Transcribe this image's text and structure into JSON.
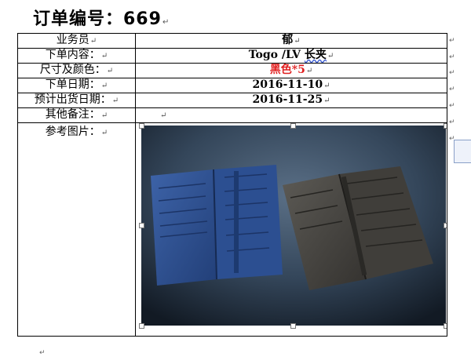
{
  "doc": {
    "title": "订单编号：669",
    "mark": "↵"
  },
  "rows": [
    {
      "label": "业务员",
      "value": "郁"
    },
    {
      "label": "下单内容：",
      "value_pre": "Togo /LV ",
      "value_word": "长夹"
    },
    {
      "label": "尺寸及颜色：",
      "value": "黑色*5"
    },
    {
      "label": "下单日期：",
      "value": "2016-11-10"
    },
    {
      "label": "预计出货日期：",
      "value": "2016-11-25"
    },
    {
      "label": "其他备注：",
      "value": ""
    },
    {
      "label": "参考图片：",
      "image": "photo-two-leather-long-wallets-blue-and-dark-grey"
    }
  ],
  "colors": {
    "accent_red": "#e02020",
    "spellcheck_blue": "#3a5bd0"
  }
}
